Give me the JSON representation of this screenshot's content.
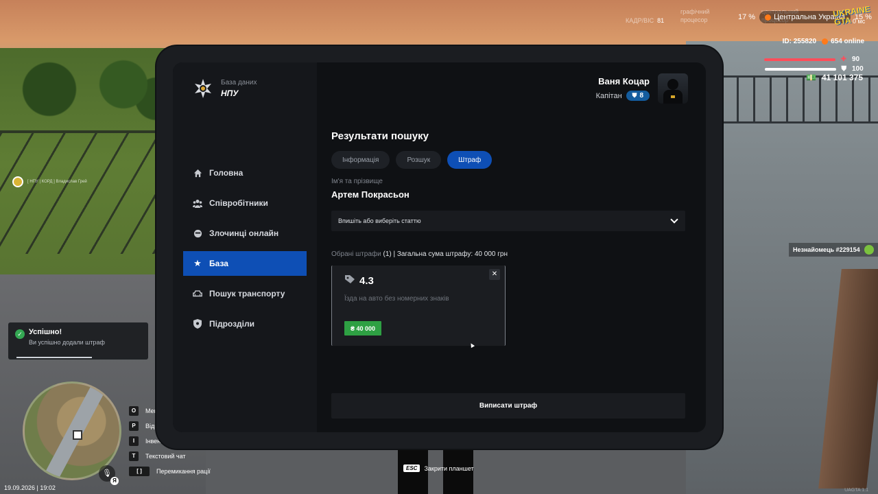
{
  "hud": {
    "fps_label": "КАДР/ВІС",
    "fps_value": "81",
    "gpu_label": "графічний процесор",
    "cpu_label": "центральний процесор",
    "region_percent_left": "17 %",
    "region": "Центральна Україна",
    "region_percent_right": "15 %",
    "ping": "0 мс",
    "game_logo": "UKRAINE GTA",
    "player_id": "ID: 255820",
    "online": "654 online",
    "health": "90",
    "armor": "100",
    "money": "41 101 375",
    "stranger_tag": "Незнайомець #229154",
    "chat_line_1": "[ НПУ | КОРД ] Владислав Грей",
    "datetime": "19.09.2026 | 19:02",
    "mic_key": "Я",
    "keybinds": [
      {
        "key": "O",
        "label": "Мені"
      },
      {
        "key": "P",
        "label": "Відк"
      },
      {
        "key": "I",
        "label": "Інвент"
      },
      {
        "key": "T",
        "label": "Текстовий чат"
      },
      {
        "key": "[ ]",
        "label": "Перемикання рації"
      }
    ],
    "esc_key": "ESC",
    "esc_label": "Закрити планшет",
    "version": "UAGTA 1.1",
    "colors": {
      "health": "#ff4d5a",
      "armor": "#ffffff",
      "online_dot": "#ff7a1a",
      "success": "#34a853"
    }
  },
  "toast": {
    "title": "Успішно!",
    "message": "Ви успішно додали штраф"
  },
  "tablet": {
    "brand": {
      "subtitle": "База даних",
      "title": "НПУ"
    },
    "user": {
      "name": "Ваня Коцар",
      "rank": "Капітан",
      "level": "8"
    },
    "nav": [
      {
        "label": "Головна",
        "icon": "home-icon",
        "active": false
      },
      {
        "label": "Співробітники",
        "icon": "users-icon",
        "active": false
      },
      {
        "label": "Злочинці онлайн",
        "icon": "criminal-icon",
        "active": false
      },
      {
        "label": "База",
        "icon": "star-icon",
        "active": true
      },
      {
        "label": "Пошук транспорту",
        "icon": "car-icon",
        "active": false
      },
      {
        "label": "Підрозділи",
        "icon": "shield-icon",
        "active": false
      }
    ],
    "page_title": "Результати пошуку",
    "tabs": [
      {
        "label": "Інформація",
        "active": false
      },
      {
        "label": "Розшук",
        "active": false
      },
      {
        "label": "Штраф",
        "active": true
      }
    ],
    "name_label": "Ім'я та прізвище",
    "name_value": "Артем Покрасьон",
    "article_select_placeholder": "Впишіть або виберіть статтю",
    "summary": {
      "label": "Обрані штрафи",
      "count": "(1)",
      "total": "| Загальна сума штрафу: 40 000 грн"
    },
    "fines": [
      {
        "code": "4.3",
        "description": "Їзда на авто без номерних знаків",
        "amount": "₴ 40 000"
      }
    ],
    "submit_label": "Виписати штраф",
    "colors": {
      "accent": "#0e4fb5",
      "price": "#2ea043",
      "rank_badge": "#145c9e"
    }
  }
}
